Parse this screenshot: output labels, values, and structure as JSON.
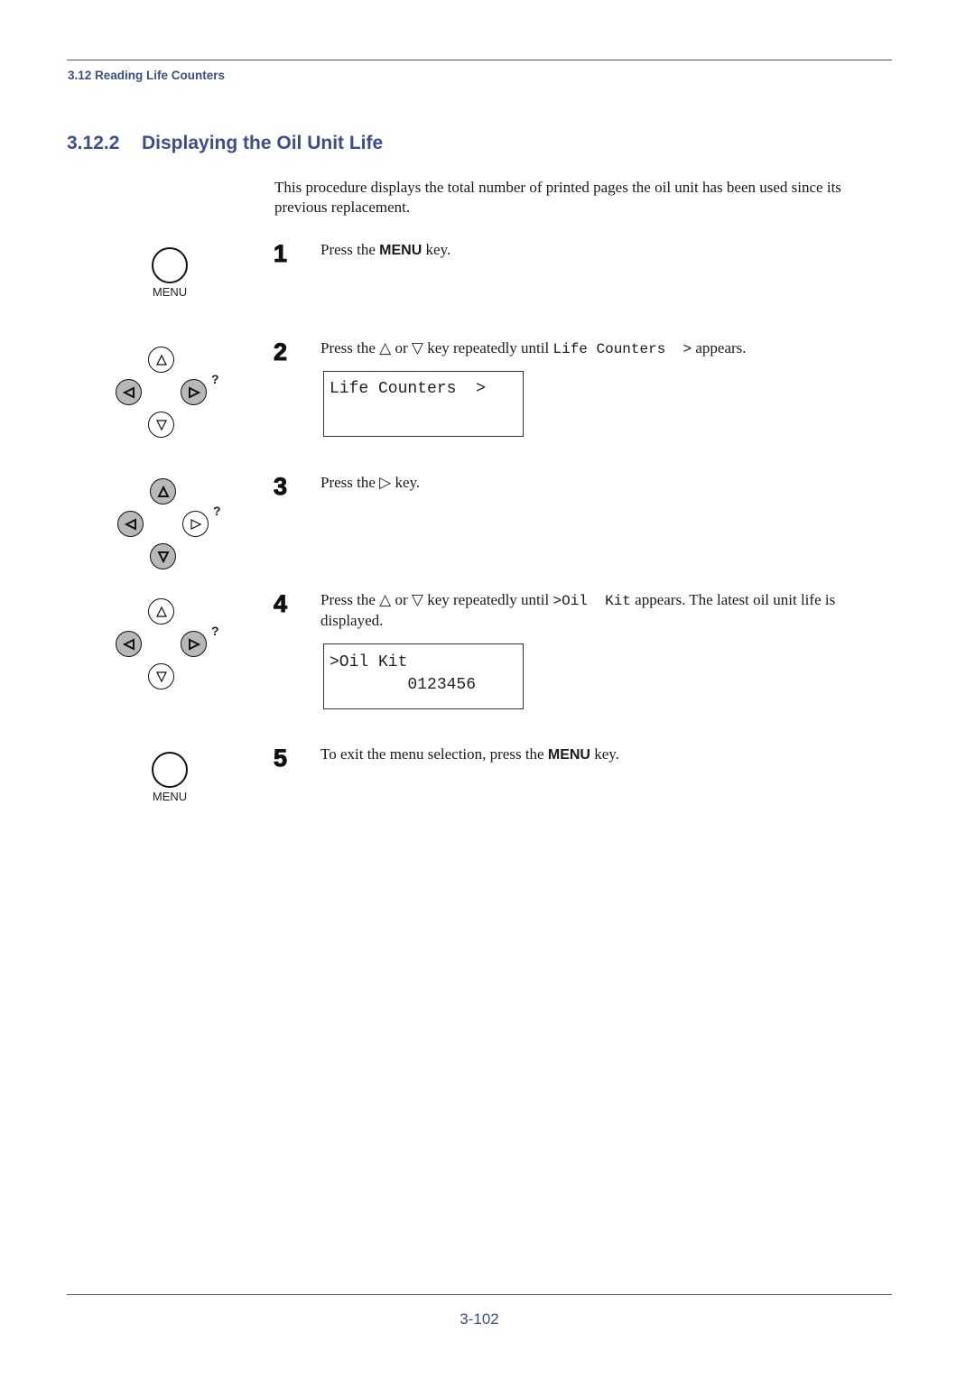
{
  "header": {
    "running_head": "3.12 Reading Life Counters"
  },
  "section": {
    "number": "3.12.2",
    "title": "Displaying the Oil Unit Life"
  },
  "intro": "This procedure displays the total number of printed pages the oil unit has been used since its previous replacement.",
  "keys": {
    "menu_label": "MENU",
    "help_symbol": "?"
  },
  "steps": [
    {
      "number": "1",
      "parts": {
        "a": "Press the ",
        "key": "MENU",
        "b": " key."
      }
    },
    {
      "number": "2",
      "parts": {
        "a": "Press the △ or ▽ key repeatedly until ",
        "mono": "Life Counters  >",
        "b": " appears."
      },
      "display": {
        "line1": "Life Counters  >",
        "line2": ""
      }
    },
    {
      "number": "3",
      "parts": {
        "a": "Press the ▷ key."
      }
    },
    {
      "number": "4",
      "parts": {
        "a": "Press the △ or ▽ key repeatedly until ",
        "mono": ">Oil  Kit",
        "b": " appears. The latest oil unit life is displayed."
      },
      "display": {
        "line1": ">Oil Kit",
        "line2": "        0123456"
      }
    },
    {
      "number": "5",
      "parts": {
        "a": "To exit the menu selection, press the ",
        "key": "MENU",
        "b": " key."
      }
    }
  ],
  "footer": {
    "page_number": "3-102"
  },
  "colors": {
    "accent": "#3b4e8c",
    "key_pressed": "#b8b8b8"
  }
}
